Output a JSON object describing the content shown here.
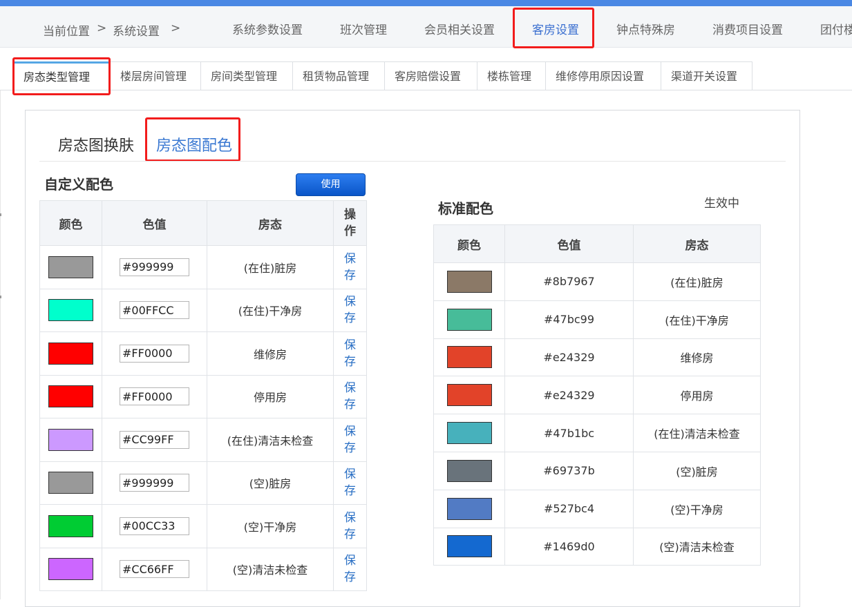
{
  "breadcrumb": {
    "location": "当前位置",
    "sep1": ">",
    "system": "系统设置",
    "sep2": ">"
  },
  "nav_tabs": [
    {
      "label": "系统参数设置"
    },
    {
      "label": "班次管理"
    },
    {
      "label": "会员相关设置"
    },
    {
      "label": "客房设置"
    },
    {
      "label": "钟点特殊房"
    },
    {
      "label": "消费项目设置"
    },
    {
      "label": "团付楼"
    }
  ],
  "sub_tabs": [
    {
      "label": "房态类型管理"
    },
    {
      "label": "楼层房间管理"
    },
    {
      "label": "房间类型管理"
    },
    {
      "label": "租赁物品管理"
    },
    {
      "label": "客房赔偿设置"
    },
    {
      "label": "楼栋管理"
    },
    {
      "label": "维修停用原因设置"
    },
    {
      "label": "渠道开关设置"
    }
  ],
  "panel_tabs": [
    {
      "label": "房态图换肤"
    },
    {
      "label": "房态图配色"
    }
  ],
  "custom": {
    "title": "自定义配色",
    "use_button": "使用",
    "headers": {
      "color": "颜色",
      "value": "色值",
      "state": "房态",
      "op": "操作"
    },
    "save_label": "保存",
    "rows": [
      {
        "color": "#999999",
        "value": "#999999",
        "state": "(在住)脏房"
      },
      {
        "color": "#00FFCC",
        "value": "#00FFCC",
        "state": "(在住)干净房"
      },
      {
        "color": "#FF0000",
        "value": "#FF0000",
        "state": "维修房"
      },
      {
        "color": "#FF0000",
        "value": "#FF0000",
        "state": "停用房"
      },
      {
        "color": "#CC99FF",
        "value": "#CC99FF",
        "state": "(在住)清洁未检查"
      },
      {
        "color": "#999999",
        "value": "#999999",
        "state": "(空)脏房"
      },
      {
        "color": "#00CC33",
        "value": "#00CC33",
        "state": "(空)干净房"
      },
      {
        "color": "#CC66FF",
        "value": "#CC66FF",
        "state": "(空)清洁未检查"
      }
    ]
  },
  "standard": {
    "title": "标准配色",
    "status": "生效中",
    "headers": {
      "color": "颜色",
      "value": "色值",
      "state": "房态"
    },
    "rows": [
      {
        "color": "#8b7967",
        "value": "#8b7967",
        "state": "(在住)脏房"
      },
      {
        "color": "#47bc99",
        "value": "#47bc99",
        "state": "(在住)干净房"
      },
      {
        "color": "#e24329",
        "value": "#e24329",
        "state": "维修房"
      },
      {
        "color": "#e24329",
        "value": "#e24329",
        "state": "停用房"
      },
      {
        "color": "#47b1bc",
        "value": "#47b1bc",
        "state": "(在住)清洁未检查"
      },
      {
        "color": "#69737b",
        "value": "#69737b",
        "state": "(空)脏房"
      },
      {
        "color": "#527bc4",
        "value": "#527bc4",
        "state": "(空)干净房"
      },
      {
        "color": "#1469d0",
        "value": "#1469d0",
        "state": "(空)清洁未检查"
      }
    ]
  },
  "colors": {
    "accent": "#3a78d2",
    "highlight_box": "#f21c1c",
    "top_bar": "#4a88e4",
    "button": "#1266dc"
  }
}
